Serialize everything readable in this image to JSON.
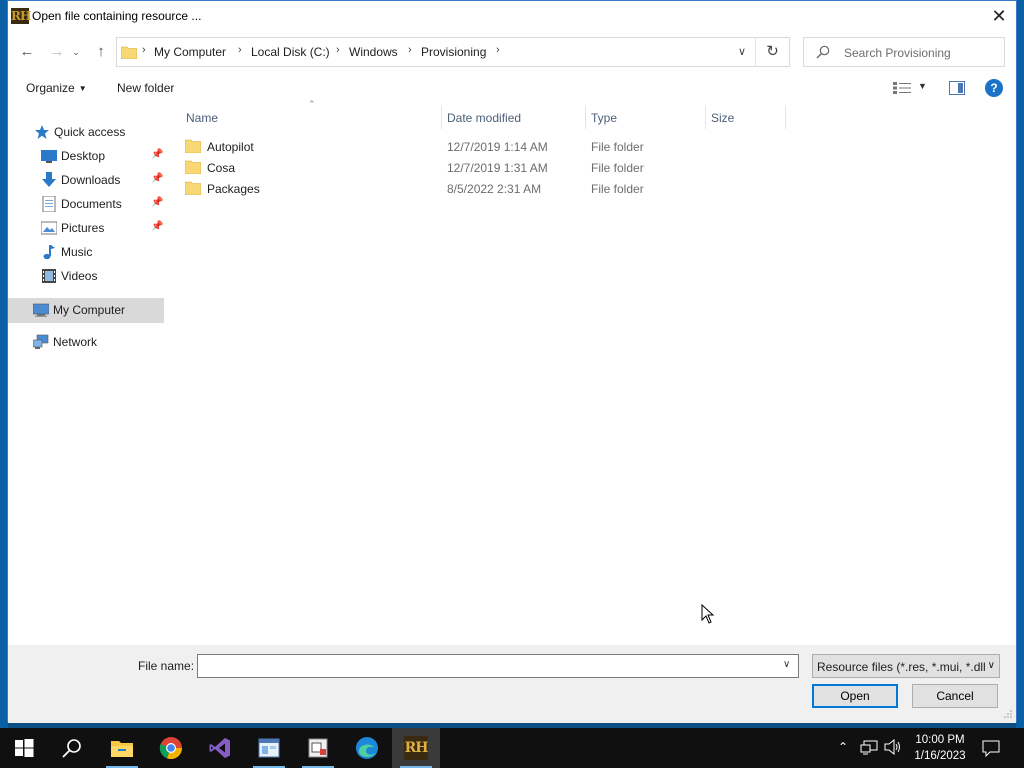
{
  "window": {
    "title": "Open file containing resource ..."
  },
  "nav": {
    "breadcrumb": [
      "My Computer",
      "Local Disk (C:)",
      "Windows",
      "Provisioning"
    ],
    "search_placeholder": "Search Provisioning"
  },
  "toolbar": {
    "organize_label": "Organize",
    "new_folder_label": "New folder"
  },
  "sidebar": {
    "quick_access": "Quick access",
    "items": [
      {
        "label": "Desktop",
        "icon": "desktop-icon",
        "pinned": true
      },
      {
        "label": "Downloads",
        "icon": "downloads-icon",
        "pinned": true
      },
      {
        "label": "Documents",
        "icon": "documents-icon",
        "pinned": true
      },
      {
        "label": "Pictures",
        "icon": "pictures-icon",
        "pinned": true
      },
      {
        "label": "Music",
        "icon": "music-icon",
        "pinned": false
      },
      {
        "label": "Videos",
        "icon": "videos-icon",
        "pinned": false
      }
    ],
    "my_computer": "My Computer",
    "network": "Network"
  },
  "list": {
    "columns": [
      "Name",
      "Date modified",
      "Type",
      "Size"
    ],
    "rows": [
      {
        "name": "Autopilot",
        "date": "12/7/2019 1:14 AM",
        "type": "File folder"
      },
      {
        "name": "Cosa",
        "date": "12/7/2019 1:31 AM",
        "type": "File folder"
      },
      {
        "name": "Packages",
        "date": "8/5/2022 2:31 AM",
        "type": "File folder"
      }
    ]
  },
  "footer": {
    "file_name_label": "File name:",
    "file_name_value": "",
    "filter_label": "Resource files (*.res, *.mui, *.dll",
    "open_label": "Open",
    "cancel_label": "Cancel"
  },
  "taskbar": {
    "time": "10:00 PM",
    "date": "1/16/2023"
  },
  "colors": {
    "accent": "#0078d7",
    "folder": "#f8d775",
    "taskbar": "#101010"
  }
}
